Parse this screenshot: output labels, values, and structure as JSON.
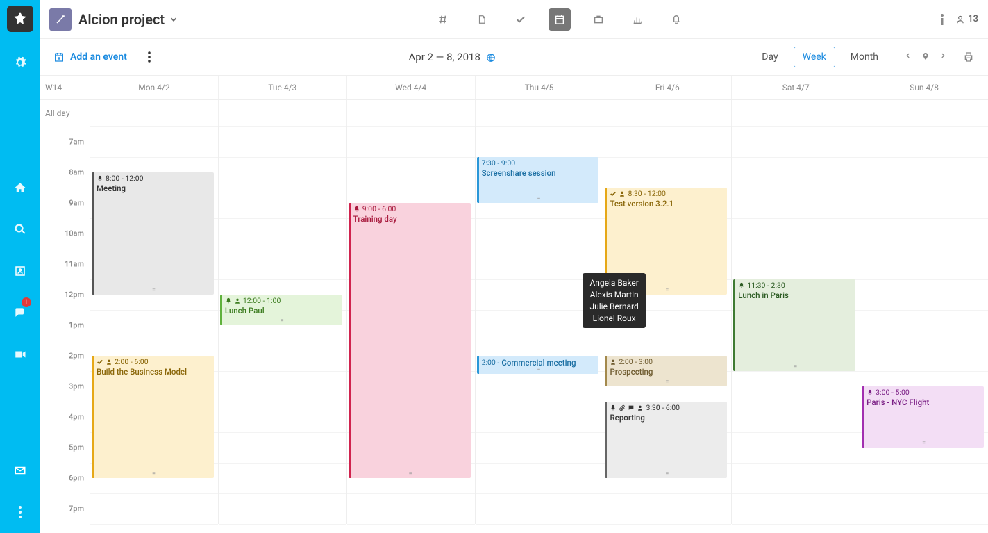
{
  "sidebar": {
    "chat_badge": "1"
  },
  "topbar": {
    "project_name": "Alcion project",
    "user_count": "13"
  },
  "subbar": {
    "add_event": "Add an event",
    "date_range": "Apr 2 — 8, 2018",
    "views": {
      "day": "Day",
      "week": "Week",
      "month": "Month"
    }
  },
  "days": {
    "week_label": "W14",
    "allday": "All day",
    "cols": [
      "Mon 4/2",
      "Tue 4/3",
      "Wed 4/4",
      "Thu 4/5",
      "Fri 4/6",
      "Sat 4/7",
      "Sun 4/8"
    ]
  },
  "hours": [
    "7am",
    "8am",
    "9am",
    "10am",
    "11am",
    "12pm",
    "1pm",
    "2pm",
    "3pm",
    "4pm",
    "5pm",
    "6pm",
    "7pm"
  ],
  "events": [
    {
      "day": 0,
      "start": 8,
      "end": 12,
      "time": "8:00 - 12:00",
      "title": "Meeting",
      "bg": "#e8e8e8",
      "bd": "#555",
      "fg": "#333",
      "icons": [
        "bell"
      ]
    },
    {
      "day": 0,
      "start": 14,
      "end": 18,
      "time": "2:00 - 6:00",
      "title": "Build the Business Model",
      "bg": "#fdf0ce",
      "bd": "#e6a817",
      "fg": "#8a6608",
      "icons": [
        "check",
        "user"
      ]
    },
    {
      "day": 1,
      "start": 12,
      "end": 13,
      "time": "12:00 - 1:00",
      "title": "Lunch Paul",
      "bg": "#e4f4da",
      "bd": "#5fb13c",
      "fg": "#3d7d21",
      "icons": [
        "bell",
        "user"
      ]
    },
    {
      "day": 2,
      "start": 9,
      "end": 18,
      "time": "9:00 - 6:00",
      "title": "Training day",
      "bg": "#f9d2dd",
      "bd": "#d0234e",
      "fg": "#a81a3d",
      "icons": [
        "bell"
      ]
    },
    {
      "day": 3,
      "start": 7.5,
      "end": 9,
      "time": "7:30 - 9:00",
      "title": "Screenshare session",
      "bg": "#d3eafb",
      "bd": "#2a97d8",
      "fg": "#1b6fa3",
      "icons": []
    },
    {
      "day": 3,
      "start": 14,
      "end": 14.6,
      "time": "2:00  -",
      "title": "Commercial meeting",
      "bg": "#d3eafb",
      "bd": "#2a97d8",
      "fg": "#1b6fa3",
      "icons": [],
      "inline": true
    },
    {
      "day": 4,
      "start": 8.5,
      "end": 12,
      "time": "8:30 - 12:00",
      "title": "Test version 3.2.1",
      "bg": "#fdf0ce",
      "bd": "#e6a817",
      "fg": "#8a6608",
      "icons": [
        "check",
        "user"
      ]
    },
    {
      "day": 4,
      "start": 14,
      "end": 15,
      "time": "2:00 - 3:00",
      "title": "Prospecting",
      "bg": "#ede4cf",
      "bd": "#a3894c",
      "fg": "#6e5b2f",
      "icons": [
        "user"
      ]
    },
    {
      "day": 4,
      "start": 15.5,
      "end": 18,
      "time": "3:30 - 6:00",
      "title": "Reporting",
      "bg": "#ececec",
      "bd": "#666",
      "fg": "#333",
      "icons": [
        "bell",
        "clip",
        "chat",
        "user"
      ]
    },
    {
      "day": 5,
      "start": 11.5,
      "end": 14.5,
      "time": "11:30 - 2:30",
      "title": "Lunch in Paris",
      "bg": "#e4eedd",
      "bd": "#3e7a32",
      "fg": "#2d5c24",
      "icons": [
        "bell"
      ]
    },
    {
      "day": 6,
      "start": 15,
      "end": 17,
      "time": "3:00 - 5:00",
      "title": "Paris - NYC Flight",
      "bg": "#f3def5",
      "bd": "#a22fb0",
      "fg": "#7b2086",
      "icons": [
        "bell"
      ]
    }
  ],
  "tooltip": {
    "lines": [
      "Angela Baker",
      "Alexis Martin",
      "Julie Bernard",
      "Lionel Roux"
    ]
  }
}
